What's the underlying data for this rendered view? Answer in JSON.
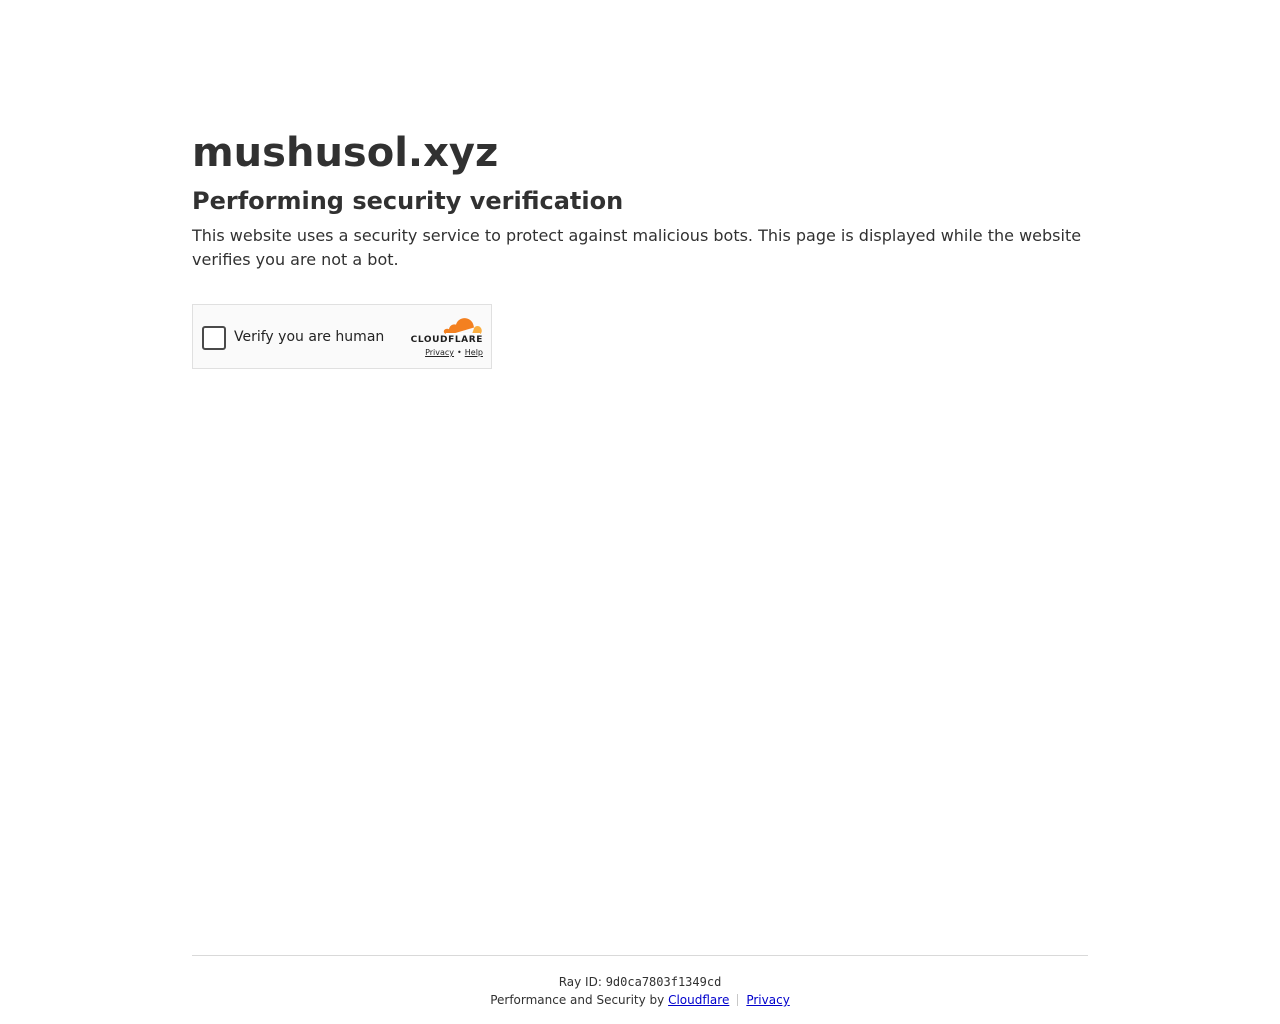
{
  "main": {
    "site_title": "mushusol.xyz",
    "heading": "Performing security verification",
    "description": "This website uses a security service to protect against malicious bots. This page is displayed while the website verifies you are not a bot."
  },
  "widget": {
    "label": "Verify you are human",
    "brand_wordmark": "CLOUDFLARE",
    "privacy_link": "Privacy",
    "separator": "•",
    "help_link": "Help",
    "checkbox_checked": false,
    "brand_icon": "cloudflare-cloud-logo",
    "brand_colors": {
      "cloud_primary": "#f38020",
      "cloud_secondary": "#faae40"
    }
  },
  "footer": {
    "ray_label": "Ray ID:",
    "ray_id": "9d0ca7803f1349cd",
    "performance_text": "Performance and Security by",
    "cloudflare_link": "Cloudflare",
    "privacy_link": "Privacy",
    "link_color": "#0000cc"
  }
}
